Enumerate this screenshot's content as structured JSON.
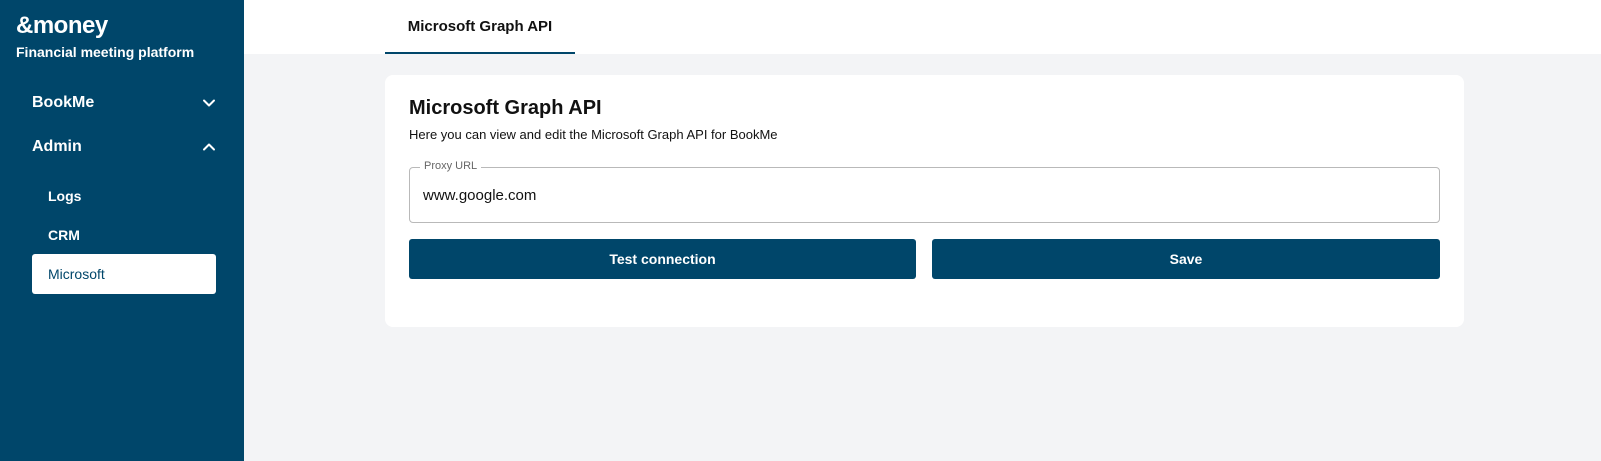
{
  "brand": {
    "logo": "&money",
    "tagline": "Financial meeting platform"
  },
  "sidebar": {
    "groups": [
      {
        "label": "BookMe",
        "state": "collapsed",
        "icon": "chevron-down-icon"
      },
      {
        "label": "Admin",
        "state": "expanded",
        "icon": "chevron-up-icon"
      }
    ],
    "admin_items": [
      {
        "label": "Logs",
        "active": false
      },
      {
        "label": "CRM",
        "active": false
      },
      {
        "label": "Microsoft",
        "active": true
      }
    ]
  },
  "tabs": [
    {
      "label": "Microsoft Graph API",
      "active": true
    }
  ],
  "card": {
    "title": "Microsoft Graph API",
    "description": "Here you can view and edit the Microsoft Graph API for BookMe",
    "proxy_url": {
      "label": "Proxy URL",
      "value": "www.google.com"
    },
    "test_button": "Test connection",
    "save_button": "Save"
  },
  "colors": {
    "primary": "#00466a",
    "background": "#f3f4f6",
    "card": "#ffffff"
  }
}
